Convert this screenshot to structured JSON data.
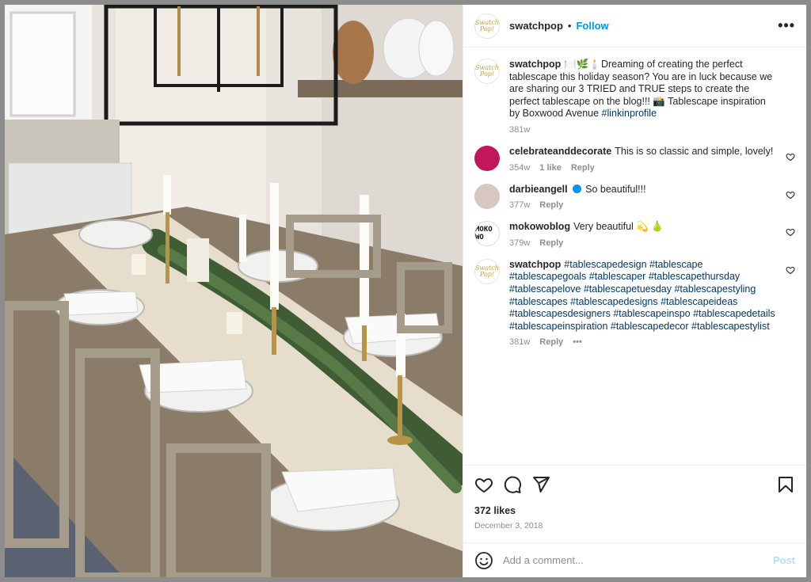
{
  "post": {
    "username": "swatchpop",
    "follow_label": "Follow",
    "more_label": "•••",
    "brand_avatar_text": "Swatch Pop!"
  },
  "caption": {
    "username": "swatchpop",
    "text": "🍽️🌿🕯️Dreaming of creating the perfect tablescape this holiday season? You are in luck because we are sharing our 3 TRIED and TRUE steps to create the perfect tablescape on the blog!!! 📸 Tablescape inspiration by Boxwood Avenue",
    "tag": "#linkinprofile",
    "time": "381w"
  },
  "comments": [
    {
      "username": "celebrateanddecorate",
      "text": "This is so classic and simple, lovely!",
      "time": "354w",
      "likes": "1 like",
      "reply": "Reply"
    },
    {
      "username": "darbieangell",
      "verified": true,
      "text": "So beautiful!!!",
      "time": "377w",
      "reply": "Reply"
    },
    {
      "username": "mokowoblog",
      "avatar_text": "MOKO WO",
      "text": "Very beautiful 💫 🍐",
      "time": "379w",
      "reply": "Reply"
    },
    {
      "username": "swatchpop",
      "tags": "#tablescapedesign #tablescape #tablescapegoals #tablescaper #tablescapethursday #tablescapelove #tablescapetuesday #tablescapestyling #tablescapes #tablescapedesigns #tablescapeideas #tablescapesdesigners #tablescapeinspo #tablescapedetails #tablescapeinspiration #tablescapedecor #tablescapestylist",
      "time": "381w",
      "reply": "Reply",
      "more": "•••"
    }
  ],
  "engagement": {
    "likes": "372 likes",
    "date": "December 3, 2018"
  },
  "comment_box": {
    "placeholder": "Add a comment...",
    "post_label": "Post"
  },
  "icons": {
    "like": "heart-icon",
    "comment": "comment-icon",
    "share": "share-icon",
    "save": "bookmark-icon",
    "emoji": "emoji-icon"
  }
}
